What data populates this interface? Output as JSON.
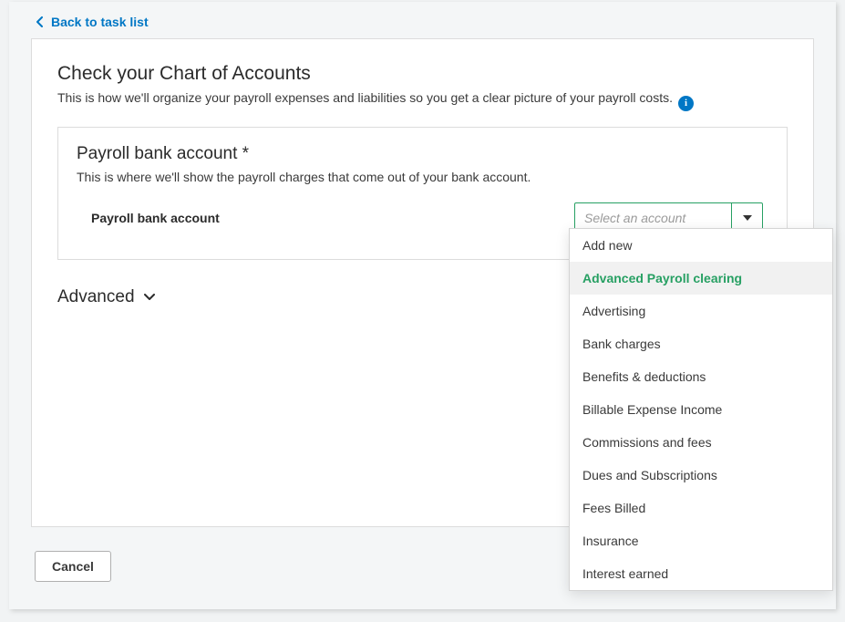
{
  "nav": {
    "back_label": "Back to task list"
  },
  "header": {
    "title": "Check your Chart of Accounts",
    "subtitle": "This is how we'll organize your payroll expenses and liabilities so you get a clear picture of your payroll costs."
  },
  "section": {
    "title": "Payroll bank account *",
    "description": "This is where we'll show the payroll charges that come out of your bank account.",
    "field_label": "Payroll bank account",
    "select_placeholder": "Select an account"
  },
  "dropdown": {
    "items": [
      {
        "label": "Add new",
        "highlighted": false
      },
      {
        "label": "Advanced Payroll clearing",
        "highlighted": true
      },
      {
        "label": "Advertising",
        "highlighted": false
      },
      {
        "label": "Bank charges",
        "highlighted": false
      },
      {
        "label": "Benefits & deductions",
        "highlighted": false
      },
      {
        "label": "Billable Expense Income",
        "highlighted": false
      },
      {
        "label": "Commissions and fees",
        "highlighted": false
      },
      {
        "label": "Dues and Subscriptions",
        "highlighted": false
      },
      {
        "label": "Fees Billed",
        "highlighted": false
      },
      {
        "label": "Insurance",
        "highlighted": false
      },
      {
        "label": "Interest earned",
        "highlighted": false
      }
    ]
  },
  "advanced": {
    "label": "Advanced"
  },
  "footer": {
    "cancel_label": "Cancel"
  },
  "colors": {
    "link": "#0077c5",
    "accent_green": "#27a063"
  }
}
